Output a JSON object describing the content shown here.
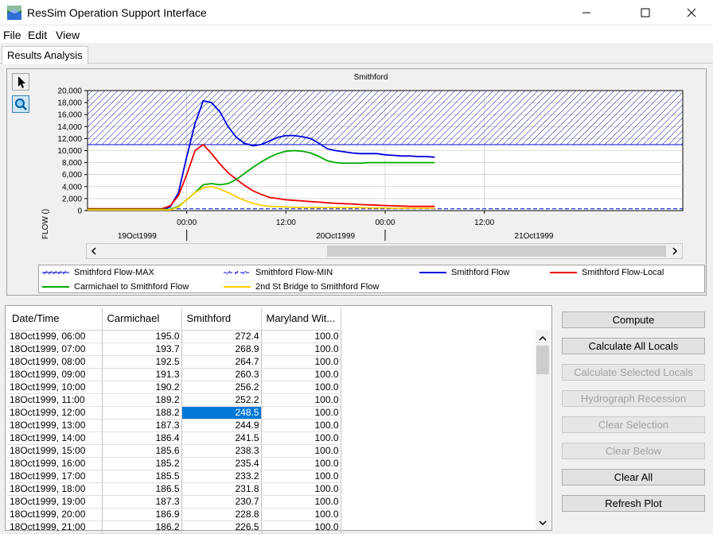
{
  "window": {
    "title": "ResSim Operation Support Interface"
  },
  "menu": [
    "File",
    "Edit",
    "View"
  ],
  "tab": "Results Analysis",
  "chart_data": {
    "type": "line",
    "title": "Smithford",
    "ylabel": "FLOW ()",
    "ylim": [
      0,
      20000
    ],
    "yticks": [
      "0",
      "2,000",
      "4,000",
      "6,000",
      "8,000",
      "10,000",
      "12,000",
      "14,000",
      "16,000",
      "18,000",
      "20,000"
    ],
    "xrange_hours": [
      0,
      72
    ],
    "xticks": [
      {
        "h": 12,
        "label": "00:00"
      },
      {
        "h": 24,
        "label": "12:00"
      },
      {
        "h": 36,
        "label": "00:00"
      },
      {
        "h": 48,
        "label": "12:00"
      }
    ],
    "day_labels": [
      {
        "h": 6,
        "label": "19Oct1999"
      },
      {
        "h": 30,
        "label": "20Oct1999"
      },
      {
        "h": 54,
        "label": "21Oct1999"
      }
    ],
    "series": [
      {
        "name": "Smithford  Flow-MAX",
        "color": "#0000cc",
        "style": "hatch",
        "values": [
          [
            0,
            11000
          ],
          [
            72,
            11000
          ]
        ]
      },
      {
        "name": "Smithford  Flow-MIN",
        "color": "#0000cc",
        "style": "dashed",
        "values": [
          [
            0,
            300
          ],
          [
            72,
            300
          ]
        ]
      },
      {
        "name": "Smithford  Flow",
        "color": "#0000dd",
        "style": "solid",
        "values": [
          [
            0,
            250
          ],
          [
            9,
            250
          ],
          [
            10,
            600
          ],
          [
            11,
            3000
          ],
          [
            12,
            9000
          ],
          [
            13,
            14500
          ],
          [
            14,
            18300
          ],
          [
            15,
            18000
          ],
          [
            16,
            16500
          ],
          [
            17,
            14000
          ],
          [
            18,
            12200
          ],
          [
            19,
            11200
          ],
          [
            20,
            10800
          ],
          [
            21,
            11000
          ],
          [
            22,
            11600
          ],
          [
            23,
            12200
          ],
          [
            24,
            12500
          ],
          [
            25,
            12500
          ],
          [
            26,
            12300
          ],
          [
            27,
            12000
          ],
          [
            28,
            11200
          ],
          [
            29,
            10300
          ],
          [
            30,
            10000
          ],
          [
            31,
            9800
          ],
          [
            32,
            9600
          ],
          [
            33,
            9500
          ],
          [
            34,
            9500
          ],
          [
            35,
            9500
          ],
          [
            36,
            9300
          ],
          [
            37,
            9200
          ],
          [
            38,
            9100
          ],
          [
            39,
            9100
          ],
          [
            40,
            9000
          ],
          [
            41,
            9000
          ],
          [
            42,
            8900
          ]
        ]
      },
      {
        "name": "Smithford  Flow-Local",
        "color": "#ee0000",
        "style": "solid",
        "values": [
          [
            0,
            300
          ],
          [
            9,
            300
          ],
          [
            10,
            800
          ],
          [
            11,
            2500
          ],
          [
            12,
            6000
          ],
          [
            13,
            10000
          ],
          [
            14,
            11000
          ],
          [
            15,
            9500
          ],
          [
            16,
            7800
          ],
          [
            17,
            6300
          ],
          [
            18,
            5200
          ],
          [
            19,
            4200
          ],
          [
            20,
            3300
          ],
          [
            21,
            2700
          ],
          [
            22,
            2200
          ],
          [
            23,
            2000
          ],
          [
            24,
            1800
          ],
          [
            25,
            1700
          ],
          [
            26,
            1600
          ],
          [
            27,
            1500
          ],
          [
            28,
            1400
          ],
          [
            29,
            1300
          ],
          [
            30,
            1200
          ],
          [
            31,
            1150
          ],
          [
            32,
            1100
          ],
          [
            33,
            1000
          ],
          [
            34,
            950
          ],
          [
            35,
            900
          ],
          [
            36,
            850
          ],
          [
            37,
            800
          ],
          [
            38,
            750
          ],
          [
            39,
            700
          ],
          [
            40,
            700
          ],
          [
            41,
            700
          ],
          [
            42,
            700
          ]
        ]
      },
      {
        "name": "Carmichael to Smithford  Flow",
        "color": "#00aa00",
        "style": "solid",
        "values": [
          [
            0,
            200
          ],
          [
            10,
            200
          ],
          [
            11,
            700
          ],
          [
            12,
            1800
          ],
          [
            13,
            3000
          ],
          [
            14,
            4300
          ],
          [
            15,
            4500
          ],
          [
            16,
            4300
          ],
          [
            17,
            4500
          ],
          [
            18,
            5200
          ],
          [
            19,
            6200
          ],
          [
            20,
            7200
          ],
          [
            21,
            8100
          ],
          [
            22,
            8900
          ],
          [
            23,
            9500
          ],
          [
            24,
            9900
          ],
          [
            25,
            10000
          ],
          [
            26,
            9900
          ],
          [
            27,
            9600
          ],
          [
            28,
            9000
          ],
          [
            29,
            8300
          ],
          [
            30,
            8000
          ],
          [
            31,
            7900
          ],
          [
            32,
            7900
          ],
          [
            33,
            7900
          ],
          [
            34,
            8000
          ],
          [
            35,
            8000
          ],
          [
            36,
            8000
          ],
          [
            37,
            8000
          ],
          [
            38,
            8000
          ],
          [
            39,
            8000
          ],
          [
            40,
            8000
          ],
          [
            41,
            8000
          ],
          [
            42,
            8000
          ]
        ]
      },
      {
        "name": "2nd St Bridge to Smithford  Flow",
        "color": "#ffcc00",
        "style": "solid",
        "values": [
          [
            0,
            100
          ],
          [
            10,
            100
          ],
          [
            11,
            600
          ],
          [
            12,
            1800
          ],
          [
            13,
            3000
          ],
          [
            14,
            3800
          ],
          [
            15,
            4000
          ],
          [
            16,
            3600
          ],
          [
            17,
            3000
          ],
          [
            18,
            2300
          ],
          [
            19,
            1700
          ],
          [
            20,
            1200
          ],
          [
            21,
            900
          ],
          [
            22,
            700
          ],
          [
            23,
            650
          ],
          [
            24,
            600
          ],
          [
            25,
            550
          ],
          [
            26,
            500
          ],
          [
            27,
            500
          ],
          [
            28,
            500
          ],
          [
            29,
            500
          ],
          [
            30,
            500
          ],
          [
            31,
            500
          ],
          [
            32,
            500
          ],
          [
            33,
            500
          ],
          [
            34,
            450
          ],
          [
            35,
            450
          ],
          [
            36,
            450
          ],
          [
            37,
            400
          ],
          [
            38,
            400
          ],
          [
            39,
            400
          ],
          [
            40,
            400
          ],
          [
            41,
            400
          ],
          [
            42,
            400
          ]
        ]
      }
    ]
  },
  "table": {
    "headers": [
      "Date/Time",
      "Carmichael",
      "Smithford",
      "Maryland Wit..."
    ],
    "rows": [
      [
        "18Oct1999, 06:00",
        "195.0",
        "272.4",
        "100.0"
      ],
      [
        "18Oct1999, 07:00",
        "193.7",
        "268.9",
        "100.0"
      ],
      [
        "18Oct1999, 08:00",
        "192.5",
        "264.7",
        "100.0"
      ],
      [
        "18Oct1999, 09:00",
        "191.3",
        "260.3",
        "100.0"
      ],
      [
        "18Oct1999, 10:00",
        "190.2",
        "256.2",
        "100.0"
      ],
      [
        "18Oct1999, 11:00",
        "189.2",
        "252.2",
        "100.0"
      ],
      [
        "18Oct1999, 12:00",
        "188.2",
        "248.5",
        "100.0"
      ],
      [
        "18Oct1999, 13:00",
        "187.3",
        "244.9",
        "100.0"
      ],
      [
        "18Oct1999, 14:00",
        "186.4",
        "241.5",
        "100.0"
      ],
      [
        "18Oct1999, 15:00",
        "185.6",
        "238.3",
        "100.0"
      ],
      [
        "18Oct1999, 16:00",
        "185.2",
        "235.4",
        "100.0"
      ],
      [
        "18Oct1999, 17:00",
        "185.5",
        "233.2",
        "100.0"
      ],
      [
        "18Oct1999, 18:00",
        "186.5",
        "231.8",
        "100.0"
      ],
      [
        "18Oct1999, 19:00",
        "187.3",
        "230.7",
        "100.0"
      ],
      [
        "18Oct1999, 20:00",
        "186.9",
        "228.8",
        "100.0"
      ],
      [
        "18Oct1999, 21:00",
        "186.2",
        "226.5",
        "100.0"
      ]
    ],
    "selected": {
      "row": 6,
      "col": 2
    }
  },
  "buttons": [
    {
      "label": "Compute",
      "enabled": true
    },
    {
      "label": "Calculate All Locals",
      "enabled": true
    },
    {
      "label": "Calculate Selected Locals",
      "enabled": false
    },
    {
      "label": "Hydrograph Recession",
      "enabled": false
    },
    {
      "label": "Clear Selection",
      "enabled": false
    },
    {
      "label": "Clear Below",
      "enabled": false
    },
    {
      "label": "Clear All",
      "enabled": true
    },
    {
      "label": "Refresh Plot",
      "enabled": true
    }
  ]
}
